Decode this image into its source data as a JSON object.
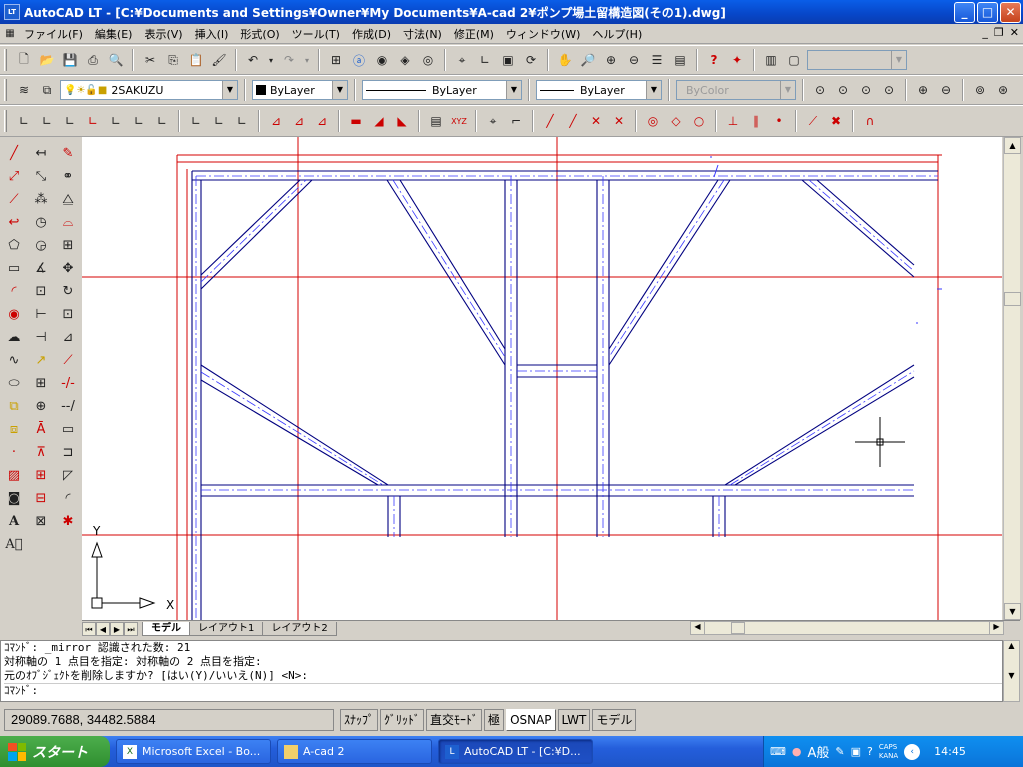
{
  "window": {
    "title": "AutoCAD LT - [C:¥Documents and Settings¥Owner¥My Documents¥A-cad 2¥ポンプ場土留構造図(その1).dwg]",
    "app_icon": "LT"
  },
  "menu": [
    "ファイル(F)",
    "編集(E)",
    "表示(V)",
    "挿入(I)",
    "形式(O)",
    "ツール(T)",
    "作成(D)",
    "寸法(N)",
    "修正(M)",
    "ウィンドウ(W)",
    "ヘルプ(H)"
  ],
  "properties": {
    "layer": "2SAKUZU",
    "color": "ByLayer",
    "linetype": "ByLayer",
    "lineweight": "ByLayer",
    "plotstyle": "ByColor"
  },
  "canvas": {
    "ucs_x": "X",
    "ucs_y": "Y"
  },
  "layout_tabs": [
    "モデル",
    "レイアウト1",
    "レイアウト2"
  ],
  "command_lines": [
    "ｺﾏﾝﾄﾞ: _mirror 認識された数: 21",
    "対称軸の 1 点目を指定: 対称軸の 2 点目を指定:",
    "元のｵﾌﾞｼﾞｪｸﾄを削除しますか? [はい(Y)/いいえ(N)] <N>:",
    "ｺﾏﾝﾄﾞ:"
  ],
  "status": {
    "coords": "29089.7688, 34482.5884",
    "buttons": [
      {
        "label": "ｽﾅｯﾌﾟ",
        "on": false
      },
      {
        "label": "ｸﾞﾘｯﾄﾞ",
        "on": false
      },
      {
        "label": "直交ﾓｰﾄﾞ",
        "on": false
      },
      {
        "label": "極",
        "on": false
      },
      {
        "label": "OSNAP",
        "on": true
      },
      {
        "label": "LWT",
        "on": false
      },
      {
        "label": "モデル",
        "on": false
      }
    ]
  },
  "taskbar": {
    "start": "スタート",
    "buttons": [
      {
        "label": "Microsoft Excel - Bo...",
        "icon": "excel-icon"
      },
      {
        "label": "A-cad 2",
        "icon": "folder-icon"
      },
      {
        "label": "AutoCAD LT - [C:¥D...",
        "icon": "autocad-icon"
      }
    ],
    "ime": "A般",
    "caps": "CAPS",
    "kana": "KANA",
    "clock": "14:45"
  },
  "colors": {
    "red_line": "#d40000",
    "dark_line": "#000080",
    "blue_line": "#3a3aff",
    "title_blue": "#0746c8"
  }
}
